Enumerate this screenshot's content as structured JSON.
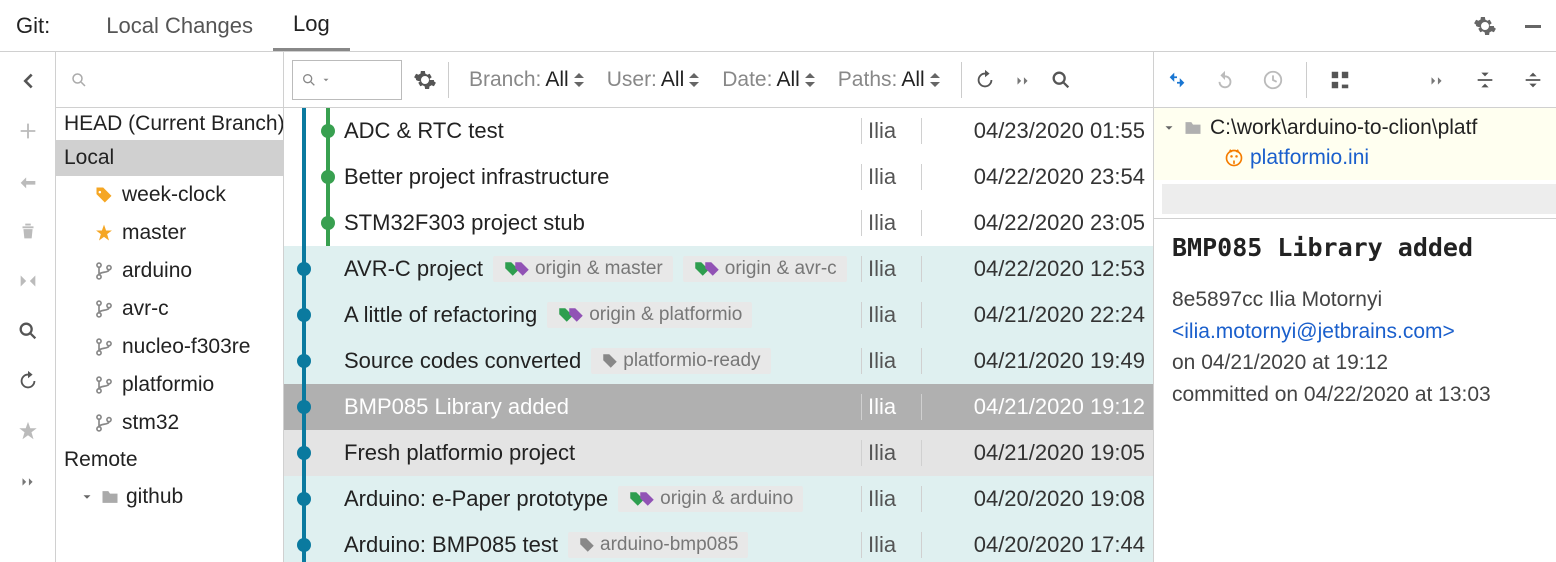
{
  "top": {
    "git_label": "Git:",
    "tab_local_changes": "Local Changes",
    "tab_log": "Log"
  },
  "branches": {
    "head": "HEAD (Current Branch)",
    "local_label": "Local",
    "local": [
      {
        "name": "week-clock",
        "icon": "tag"
      },
      {
        "name": "master",
        "icon": "star"
      },
      {
        "name": "arduino",
        "icon": "branch"
      },
      {
        "name": "avr-c",
        "icon": "branch"
      },
      {
        "name": "nucleo-f303re",
        "icon": "branch"
      },
      {
        "name": "platformio",
        "icon": "branch"
      },
      {
        "name": "stm32",
        "icon": "branch"
      }
    ],
    "remote_label": "Remote",
    "remote_name": "github"
  },
  "filters": {
    "branch_label": "Branch:",
    "branch_val": "All",
    "user_label": "User:",
    "user_val": "All",
    "date_label": "Date:",
    "date_val": "All",
    "paths_label": "Paths:",
    "paths_val": "All"
  },
  "commits": [
    {
      "msg": "ADC & RTC test",
      "author": "Ilia",
      "date": "04/23/2020 01:55",
      "dot": "green",
      "hl": false,
      "tags": []
    },
    {
      "msg": "Better project infrastructure",
      "author": "Ilia",
      "date": "04/22/2020 23:54",
      "dot": "green",
      "hl": false,
      "tags": []
    },
    {
      "msg": "STM32F303 project stub",
      "author": "Ilia",
      "date": "04/22/2020 23:05",
      "dot": "green",
      "hl": false,
      "tags": []
    },
    {
      "msg": "AVR-C project",
      "author": "Ilia",
      "date": "04/22/2020 12:53",
      "dot": "blue",
      "hl": true,
      "tags": [
        {
          "t": "origin & master",
          "c": "color"
        },
        {
          "t": "origin & avr-c",
          "c": "color"
        }
      ]
    },
    {
      "msg": "A little of refactoring",
      "author": "Ilia",
      "date": "04/21/2020 22:24",
      "dot": "blue",
      "hl": true,
      "tags": [
        {
          "t": "origin & platformio",
          "c": "color"
        }
      ]
    },
    {
      "msg": "Source codes converted",
      "author": "Ilia",
      "date": "04/21/2020 19:49",
      "dot": "blue",
      "hl": true,
      "tags": [
        {
          "t": "platformio-ready",
          "c": "gray"
        }
      ]
    },
    {
      "msg": "BMP085 Library added",
      "author": "Ilia",
      "date": "04/21/2020 19:12",
      "dot": "blue",
      "hl": false,
      "selected": true,
      "tags": []
    },
    {
      "msg": "Fresh platformio project",
      "author": "Ilia",
      "date": "04/21/2020 19:05",
      "dot": "blue",
      "hl": false,
      "lightsel": true,
      "tags": []
    },
    {
      "msg": "Arduino: e-Paper prototype",
      "author": "Ilia",
      "date": "04/20/2020 19:08",
      "dot": "blue",
      "hl": true,
      "tags": [
        {
          "t": "origin & arduino",
          "c": "color"
        }
      ]
    },
    {
      "msg": "Arduino: BMP085 test",
      "author": "Ilia",
      "date": "04/20/2020 17:44",
      "dot": "blue",
      "hl": true,
      "tags": [
        {
          "t": "arduino-bmp085",
          "c": "gray"
        }
      ]
    }
  ],
  "tree": {
    "root_path": "C:\\work\\arduino-to-clion\\platf",
    "file": "platformio.ini"
  },
  "details": {
    "title": "BMP085 Library added",
    "hash": "8e5897cc",
    "author_name": "Ilia Motornyi",
    "email": "<ilia.motornyi@jetbrains.com>",
    "authored": "on 04/21/2020 at 19:12",
    "committed": "committed on 04/22/2020 at 13:03"
  }
}
